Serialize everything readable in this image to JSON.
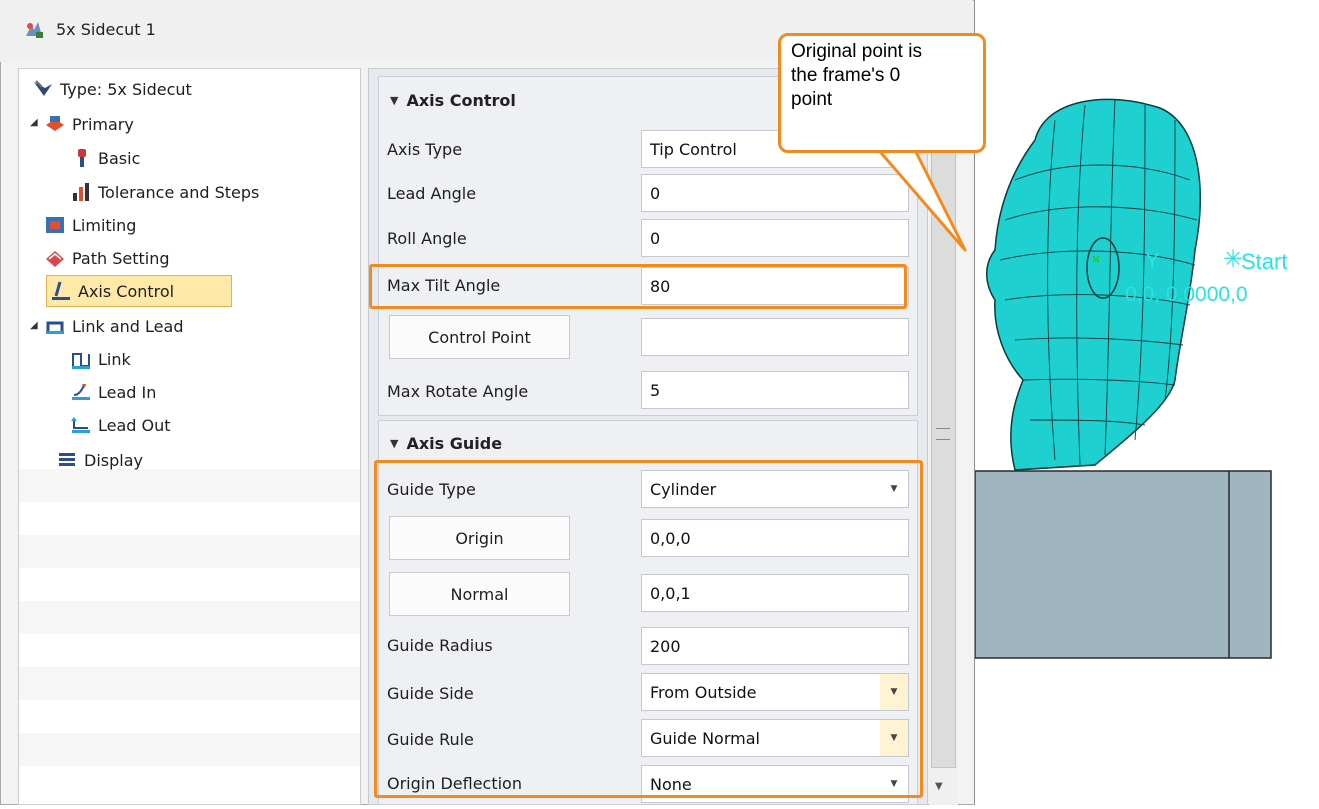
{
  "window": {
    "title": "5x Sidecut 1",
    "icon": "toolpath-icon"
  },
  "tree": {
    "items": [
      {
        "label": "Type: 5x Sidecut",
        "icon": "type-icon",
        "level": 0
      },
      {
        "label": "Primary",
        "icon": "primary-icon",
        "level": 0,
        "expanded": true
      },
      {
        "label": "Basic",
        "icon": "tool-icon",
        "level": 1
      },
      {
        "label": "Tolerance and Steps",
        "icon": "steps-icon",
        "level": 1
      },
      {
        "label": "Limiting",
        "icon": "limiting-icon",
        "level": 0
      },
      {
        "label": "Path Setting",
        "icon": "path-icon",
        "level": 0
      },
      {
        "label": "Axis Control",
        "icon": "axis-icon",
        "level": 0,
        "selected": true
      },
      {
        "label": "Link and Lead",
        "icon": "link-lead-icon",
        "level": 0,
        "expanded": true
      },
      {
        "label": "Link",
        "icon": "link-icon",
        "level": 1
      },
      {
        "label": "Lead In",
        "icon": "lead-in-icon",
        "level": 1
      },
      {
        "label": "Lead Out",
        "icon": "lead-out-icon",
        "level": 1
      },
      {
        "label": "Display",
        "icon": "display-icon",
        "level": 0
      }
    ]
  },
  "axis_control": {
    "header": "Axis Control",
    "axis_type_label": "Axis Type",
    "axis_type_value": "Tip Control",
    "lead_angle_label": "Lead Angle",
    "lead_angle_value": "0",
    "roll_angle_label": "Roll Angle",
    "roll_angle_value": "0",
    "max_tilt_label": "Max Tilt Angle",
    "max_tilt_value": "80",
    "control_point_button": "Control Point",
    "control_point_value": "",
    "max_rotate_label": "Max Rotate Angle",
    "max_rotate_value": "5"
  },
  "axis_guide": {
    "header": "Axis Guide",
    "guide_type_label": "Guide Type",
    "guide_type_value": "Cylinder",
    "origin_button": "Origin",
    "origin_value": "0,0,0",
    "normal_button": "Normal",
    "normal_value": "0,0,1",
    "guide_radius_label": "Guide Radius",
    "guide_radius_value": "200",
    "guide_side_label": "Guide Side",
    "guide_side_value": "From Outside",
    "guide_rule_label": "Guide Rule",
    "guide_rule_value": "Guide Normal",
    "origin_deflection_label": "Origin Deflection",
    "origin_deflection_value": "None"
  },
  "callout": {
    "line1": "Original point is",
    "line2": "the frame's 0",
    "line3": "point"
  },
  "viewport": {
    "start_label": "Start",
    "coord_text": "0,0, 0.0000,0",
    "axis_label": "Y"
  },
  "colors": {
    "highlight": "#f28b1e",
    "mesh": "#1fd0d0",
    "selection": "#ffe9a8",
    "cyan_text": "#27e3e3"
  }
}
